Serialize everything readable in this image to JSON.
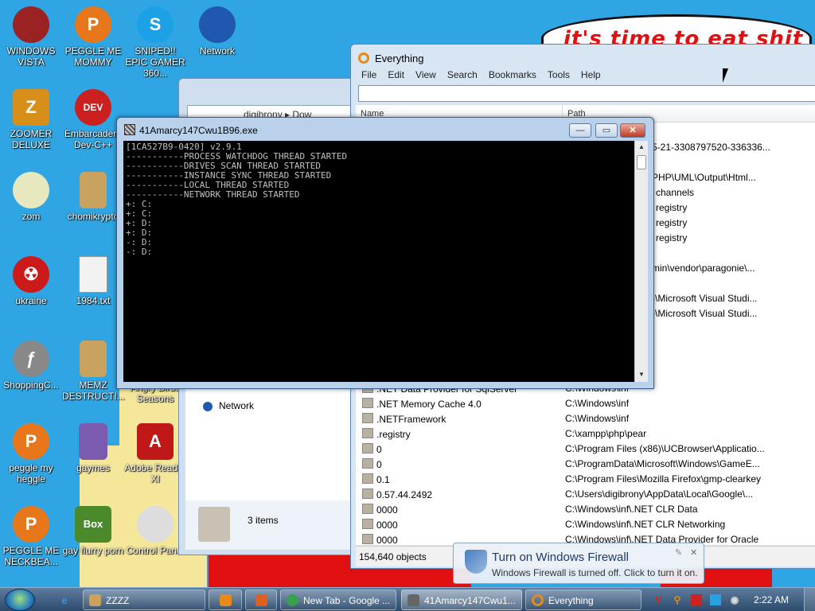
{
  "desktop": {
    "wallpaper_text": "it's time to eat shit",
    "icons": [
      {
        "label": "WINDOWS VISTA",
        "icon": "vista-icon",
        "color": "#9a2222"
      },
      {
        "label": "PEGGLE ME MOMMY",
        "icon": "peggle-icon",
        "color": "#e8771c"
      },
      {
        "label": "SNIPED!! EPIC GAMER 360...",
        "icon": "skype-icon",
        "color": "#1da1e6"
      },
      {
        "label": "Network",
        "icon": "network-icon",
        "color": "#2058b0"
      },
      {
        "label": "ZOOMER DELUXE",
        "icon": "zoomer-icon",
        "color": "#d88f1a"
      },
      {
        "label": "Embarcadero Dev-C++",
        "icon": "devcpp-icon",
        "color": "#cc2020"
      },
      {
        "label": "zom",
        "icon": "flower-icon",
        "color": "#e7e7c0"
      },
      {
        "label": "chomikrypto",
        "icon": "script-icon",
        "color": "#caa260"
      },
      {
        "label": "ukraine",
        "icon": "radiation-icon",
        "color": "#cc1a1a"
      },
      {
        "label": "1984.txt",
        "icon": "text-file-icon",
        "color": "#f2f2f2"
      },
      {
        "label": "ShoppingC...",
        "icon": "flash-icon",
        "color": "#888888"
      },
      {
        "label": "MEMZ DESTRUCTI...",
        "icon": "script-icon",
        "color": "#caa260"
      },
      {
        "label": "Angry Birds Seasons",
        "icon": "angry-birds-icon",
        "color": "#333333"
      },
      {
        "label": "peggle my heggle",
        "icon": "peggle-icon",
        "color": "#e8771c"
      },
      {
        "label": "gaymes",
        "icon": "folder-icon",
        "color": "#7a5bb0"
      },
      {
        "label": "Adobe Reader XI",
        "icon": "adobe-reader-icon",
        "color": "#c01818"
      },
      {
        "label": "PEGGLE ME NECKBEA...",
        "icon": "peggle-icon",
        "color": "#e8771c"
      },
      {
        "label": "gay flurry porn",
        "icon": "box-game-icon",
        "color": "#4a8a2a"
      },
      {
        "label": "Control Panel",
        "icon": "control-panel-icon",
        "color": "#dddddd"
      }
    ]
  },
  "explorer": {
    "breadcrumb": "digibrony ▸ Dow",
    "nav_item": "Network",
    "status": "3 items"
  },
  "everything": {
    "title": "Everything",
    "menu": [
      "File",
      "Edit",
      "View",
      "Search",
      "Bookmarks",
      "Tools",
      "Help"
    ],
    "search_value": "",
    "col_name": "Name",
    "col_path": "Path",
    "visible_fragments": [
      "5-21-3308797520-336336...",
      "PHP\\UML\\Output\\Html...",
      "channels",
      "registry",
      "registry",
      "registry",
      "min\\vendor\\paragonie\\...",
      ")\\Microsoft Visual Studi...",
      ")\\Microsoft Visual Studi..."
    ],
    "rows": [
      {
        "name": ".NET Data Provider for SqlServer",
        "path": "C:\\Windows\\inf"
      },
      {
        "name": ".NET Memory Cache 4.0",
        "path": "C:\\Windows\\inf"
      },
      {
        "name": ".NETFramework",
        "path": "C:\\Windows\\inf"
      },
      {
        "name": ".registry",
        "path": "C:\\xampp\\php\\pear"
      },
      {
        "name": "0",
        "path": "C:\\Program Files (x86)\\UCBrowser\\Applicatio..."
      },
      {
        "name": "0",
        "path": "C:\\ProgramData\\Microsoft\\Windows\\GameE..."
      },
      {
        "name": "0.1",
        "path": "C:\\Program Files\\Mozilla Firefox\\gmp-clearkey"
      },
      {
        "name": "0.57.44.2492",
        "path": "C:\\Users\\digibrony\\AppData\\Local\\Google\\..."
      },
      {
        "name": "0000",
        "path": "C:\\Windows\\inf\\.NET CLR Data"
      },
      {
        "name": "0000",
        "path": "C:\\Windows\\inf\\.NET CLR Networking"
      },
      {
        "name": "0000",
        "path": "C:\\Windows\\inf\\.NET Data Provider for Oracle"
      }
    ],
    "status": "154,640 objects"
  },
  "console": {
    "title": "41Amarcy147Cwu1B96.exe",
    "btn_min": "—",
    "btn_max": "▭",
    "btn_close": "✕",
    "lines": [
      "[1CA527B9-0420] v2.9.1",
      "-----------PROCESS WATCHDOG THREAD STARTED",
      "-----------DRIVES SCAN THREAD STARTED",
      "-----------INSTANCE SYNC THREAD STARTED",
      "-----------LOCAL THREAD STARTED",
      "-----------NETWORK THREAD STARTED",
      "+: C:",
      "+: C:",
      "+: D:",
      "+: D:",
      "-: D:",
      "-: D:"
    ]
  },
  "balloon": {
    "title": "Turn on Windows Firewall",
    "body": "Windows Firewall is turned off. Click to turn it on."
  },
  "taskbar": {
    "buttons": [
      {
        "label": "ZZZZ",
        "icon": "script-icon",
        "color": "#caa260"
      },
      {
        "label": "",
        "icon": "media-player-icon",
        "color": "#e68a1a"
      },
      {
        "label": "",
        "icon": "paint-icon",
        "color": "#e06020"
      },
      {
        "label": "New Tab - Google ...",
        "icon": "chrome-icon",
        "color": "#3aa050"
      },
      {
        "label": "41Amarcy147Cwu1...",
        "icon": "console-icon",
        "color": "#666666"
      },
      {
        "label": "Everything",
        "icon": "everything-icon",
        "color": "#e68a1a"
      }
    ],
    "clock": "2:22 AM"
  }
}
